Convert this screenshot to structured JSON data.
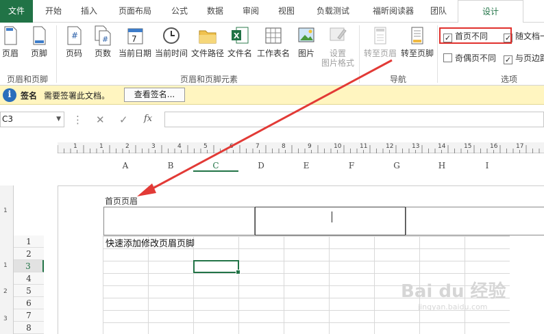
{
  "tabs": [
    "文件",
    "开始",
    "插入",
    "页面布局",
    "公式",
    "数据",
    "审阅",
    "视图",
    "负载测试",
    "福昕阅读器",
    "团队",
    "设计"
  ],
  "ribbon": {
    "groups": {
      "header_footer": "页眉和页脚",
      "elements": "页眉和页脚元素",
      "navigation": "导航",
      "options": "选项"
    },
    "header_btn": "页眉",
    "footer_btn": "页脚",
    "page_number": "页码",
    "page_count": "页数",
    "current_date": "当前日期",
    "current_time": "当前时间",
    "file_path": "文件路径",
    "file_name": "文件名",
    "sheet_name": "工作表名",
    "picture": "图片",
    "format_picture_1": "设置",
    "format_picture_2": "图片格式",
    "goto_header": "转至页眉",
    "goto_footer": "转至页脚",
    "opt_first_page": "首页不同",
    "opt_odd_even": "奇偶页不同",
    "opt_scale": "随文档一",
    "opt_align": "与页边距"
  },
  "message": {
    "title": "签名",
    "text": "需要签署此文档。",
    "button": "查看签名..."
  },
  "namebox": "C3",
  "columns": [
    "A",
    "B",
    "C",
    "D",
    "E",
    "F",
    "G",
    "H",
    "I"
  ],
  "rows": [
    "1",
    "2",
    "3",
    "4",
    "5",
    "6",
    "7",
    "8"
  ],
  "header_label": "首页页眉",
  "cell_a1": "快速添加修改页眉页脚",
  "ruler_top": [
    "1",
    "1",
    "2",
    "3",
    "4",
    "5",
    "6",
    "7",
    "8",
    "9",
    "10",
    "11",
    "12",
    "13",
    "14",
    "15",
    "16",
    "17"
  ],
  "ruler_left": [
    "1",
    "1",
    "2",
    "3"
  ],
  "watermark": "Bai du 经验",
  "watermark_sub": "jingyan.baidu.com"
}
